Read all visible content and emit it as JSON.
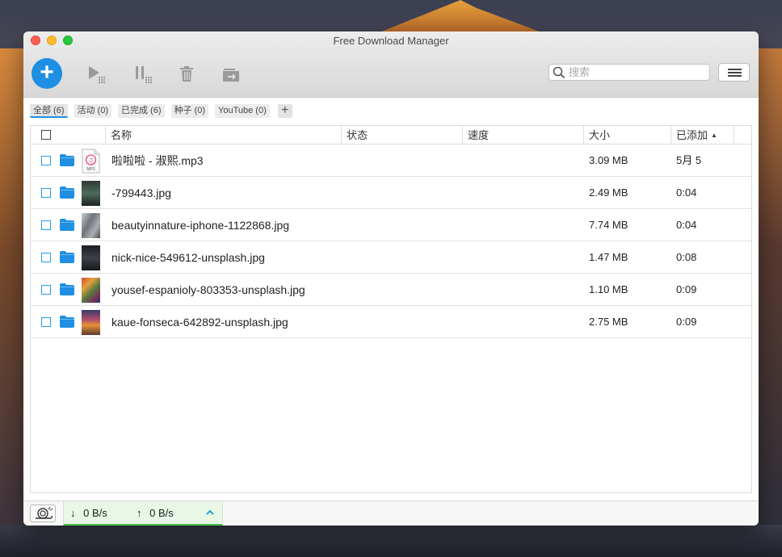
{
  "window": {
    "title": "Free Download Manager"
  },
  "search": {
    "placeholder": "搜索"
  },
  "filters": [
    {
      "label": "全部 (6)",
      "active": true
    },
    {
      "label": "活动 (0)",
      "active": false
    },
    {
      "label": "已完成 (6)",
      "active": false
    },
    {
      "label": "种子 (0)",
      "active": false
    },
    {
      "label": "YouTube (0)",
      "active": false
    }
  ],
  "filter_add_label": "+",
  "columns": {
    "name": "名称",
    "status": "状态",
    "speed": "速度",
    "size": "大小",
    "added": "已添加"
  },
  "downloads": [
    {
      "name": "啦啦啦 - 淑熙.mp3",
      "status": "",
      "speed": "",
      "size": "3.09 MB",
      "added": "5月 5",
      "thumb": "mp3"
    },
    {
      "name": "-799443.jpg",
      "status": "",
      "speed": "",
      "size": "2.49 MB",
      "added": "0:04",
      "thumb": "photo-dark-green"
    },
    {
      "name": "beautyinnature-iphone-1122868.jpg",
      "status": "",
      "speed": "",
      "size": "7.74 MB",
      "added": "0:04",
      "thumb": "photo-grey"
    },
    {
      "name": "nick-nice-549612-unsplash.jpg",
      "status": "",
      "speed": "",
      "size": "1.47 MB",
      "added": "0:08",
      "thumb": "photo-dark"
    },
    {
      "name": "yousef-espanioly-803353-unsplash.jpg",
      "status": "",
      "speed": "",
      "size": "1.10 MB",
      "added": "0:09",
      "thumb": "photo-colorful"
    },
    {
      "name": "kaue-fonseca-642892-unsplash.jpg",
      "status": "",
      "speed": "",
      "size": "2.75 MB",
      "added": "0:09",
      "thumb": "photo-sunset"
    }
  ],
  "mp3_badge": "MP3",
  "status": {
    "down_speed": "0 B/s",
    "up_speed": "0 B/s"
  },
  "colors": {
    "accent": "#1e8fe3",
    "speed_bar": "#4cc24c"
  }
}
